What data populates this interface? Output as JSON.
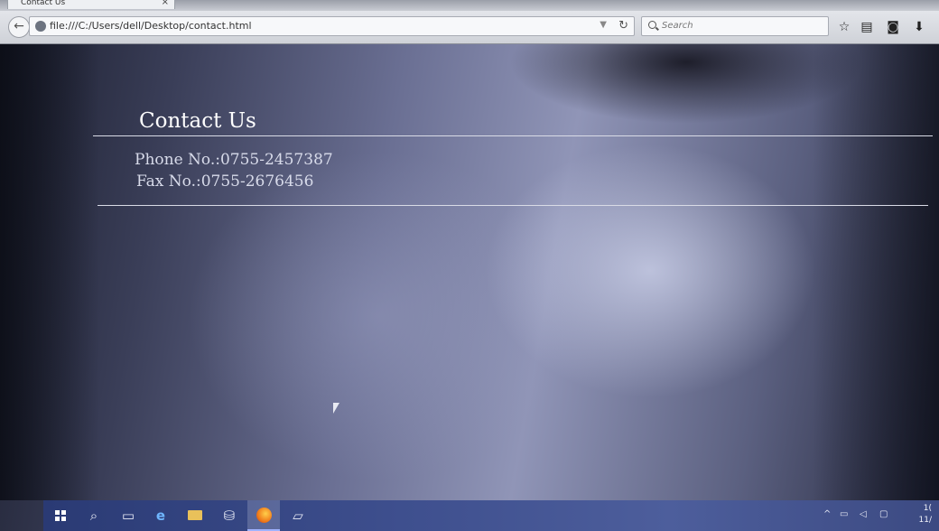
{
  "browser": {
    "tab_title": "Contact Us",
    "tab_close": "×",
    "url": "file:///C:/Users/dell/Desktop/contact.html",
    "search_placeholder": "Search",
    "icons": [
      "back-icon",
      "globe-icon",
      "dropdown-icon",
      "reload-icon",
      "search-icon",
      "bookmark-star-icon",
      "reading-list-icon",
      "pocket-icon",
      "download-icon"
    ]
  },
  "page": {
    "heading": "Contact Us",
    "phone": "Phone No.:0755-2457387",
    "fax": "Fax No.:0755-2676456"
  },
  "taskbar": {
    "clock_line1": "1(",
    "clock_line2": "11/"
  }
}
